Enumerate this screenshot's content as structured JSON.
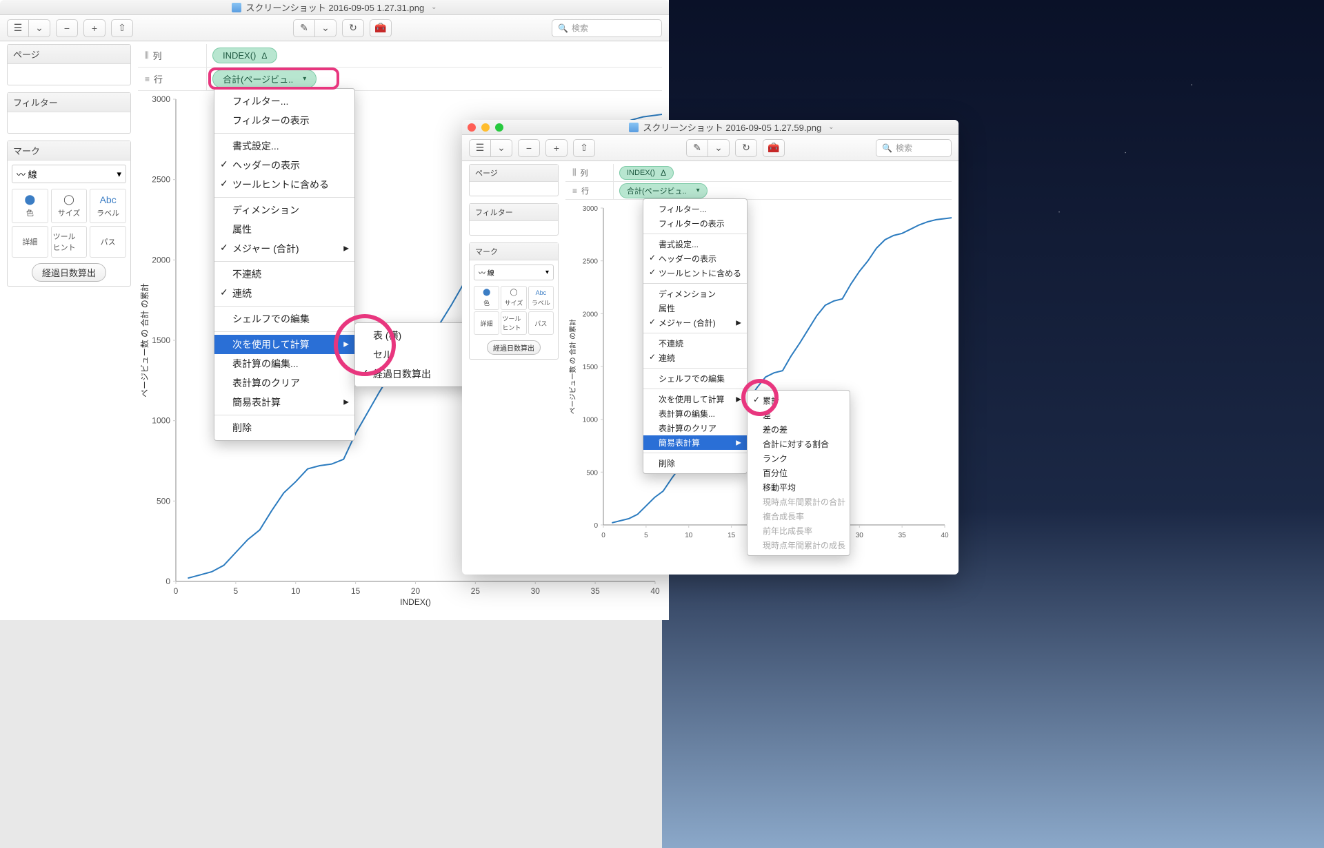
{
  "window1": {
    "title": "スクリーンショット 2016-09-05 1.27.31.png",
    "search_placeholder": "検索",
    "shelves": {
      "columns_label": "列",
      "columns_pill": "INDEX()",
      "rows_label": "行",
      "rows_pill": "合計(ページビュ.."
    },
    "side": {
      "pages": "ページ",
      "filter": "フィルター",
      "marks": "マーク",
      "marks_type": "線",
      "cells": {
        "color": "色",
        "size": "サイズ",
        "label": "ラベル",
        "detail": "詳細",
        "tooltip": "ツール\nヒント",
        "path": "パス"
      },
      "field": "経過日数算出"
    },
    "menu1": {
      "filter": "フィルター...",
      "show_filter": "フィルターの表示",
      "format": "書式設定...",
      "show_header": "ヘッダーの表示",
      "include_tooltip": "ツールヒントに含める",
      "dimension": "ディメンション",
      "attribute": "属性",
      "measure_sum": "メジャー (合計)",
      "discrete": "不連続",
      "continuous": "連続",
      "edit_shelf": "シェルフでの編集",
      "compute_using": "次を使用して計算",
      "edit_tablecalc": "表計算の編集...",
      "clear_tablecalc": "表計算のクリア",
      "quick_tablecalc": "簡易表計算",
      "remove": "削除"
    },
    "submenu1": {
      "table": "表 (横)",
      "cell": "セル",
      "elapsed": "経過日数算出"
    }
  },
  "window2": {
    "title": "スクリーンショット 2016-09-05 1.27.59.png",
    "search_placeholder": "検索",
    "shelves": {
      "columns_label": "列",
      "columns_pill": "INDEX()",
      "rows_label": "行",
      "rows_pill": "合計(ページビュ.."
    },
    "side": {
      "pages": "ページ",
      "filter": "フィルター",
      "marks": "マーク",
      "marks_type": "線",
      "cells": {
        "color": "色",
        "size": "サイズ",
        "label": "ラベル",
        "detail": "詳細",
        "tooltip": "ツール\nヒント",
        "path": "パス"
      },
      "field": "経過日数算出"
    },
    "menu2": {
      "filter": "フィルター...",
      "show_filter": "フィルターの表示",
      "format": "書式設定...",
      "show_header": "ヘッダーの表示",
      "include_tooltip": "ツールヒントに含める",
      "dimension": "ディメンション",
      "attribute": "属性",
      "measure_sum": "メジャー (合計)",
      "discrete": "不連続",
      "continuous": "連続",
      "edit_shelf": "シェルフでの編集",
      "compute_using": "次を使用して計算",
      "edit_tablecalc": "表計算の編集...",
      "clear_tablecalc": "表計算のクリア",
      "quick_tablecalc": "簡易表計算",
      "remove": "削除"
    },
    "submenu2": {
      "running_total": "累計",
      "difference": "差",
      "pct_diff": "差の差",
      "pct_of_total": "合計に対する割合",
      "rank": "ランク",
      "percentile": "百分位",
      "moving_avg": "移動平均",
      "ytd_total": "現時点年間累計の合計",
      "compound_growth": "複合成長率",
      "yoy_growth": "前年比成長率",
      "ytd_growth": "現時点年間累計の成長"
    }
  },
  "chart_data": [
    {
      "type": "line",
      "title": "",
      "xlabel": "INDEX()",
      "ylabel": "ページビュー数 の 合計 の累計",
      "xlim": [
        0,
        40
      ],
      "ylim": [
        0,
        3000
      ],
      "xticks": [
        0,
        5,
        10,
        15,
        20,
        25,
        30,
        35,
        40
      ],
      "yticks": [
        0,
        500,
        1000,
        1500,
        2000,
        2500,
        3000
      ],
      "x": [
        1,
        2,
        3,
        4,
        5,
        6,
        7,
        8,
        9,
        10,
        11,
        12,
        13,
        14,
        15,
        16,
        17,
        18,
        19,
        20,
        21,
        22,
        23,
        24,
        25,
        26,
        27,
        28,
        29,
        30,
        31,
        32,
        33,
        34,
        35,
        36,
        37,
        38,
        39,
        40,
        41,
        42,
        43
      ],
      "values": [
        20,
        40,
        60,
        100,
        180,
        260,
        320,
        440,
        550,
        620,
        700,
        720,
        730,
        760,
        920,
        1050,
        1180,
        1300,
        1400,
        1440,
        1460,
        1600,
        1720,
        1850,
        1980,
        2080,
        2120,
        2140,
        2280,
        2400,
        2500,
        2620,
        2700,
        2740,
        2760,
        2800,
        2840,
        2870,
        2890,
        2900,
        2910,
        2920,
        2930
      ]
    },
    {
      "type": "line",
      "title": "",
      "xlabel": "INDEX()",
      "ylabel": "ページビュー数 の 合計 の累計",
      "xlim": [
        0,
        40
      ],
      "ylim": [
        0,
        3000
      ],
      "xticks": [
        0,
        5,
        10,
        15,
        20,
        25,
        30,
        35,
        40
      ],
      "yticks": [
        0,
        500,
        1000,
        1500,
        2000,
        2500,
        3000
      ],
      "x": [
        1,
        2,
        3,
        4,
        5,
        6,
        7,
        8,
        9,
        10,
        11,
        12,
        13,
        14,
        15,
        16,
        17,
        18,
        19,
        20,
        21,
        22,
        23,
        24,
        25,
        26,
        27,
        28,
        29,
        30,
        31,
        32,
        33,
        34,
        35,
        36,
        37,
        38,
        39,
        40,
        41,
        42,
        43
      ],
      "values": [
        20,
        40,
        60,
        100,
        180,
        260,
        320,
        440,
        550,
        620,
        700,
        720,
        730,
        760,
        920,
        1050,
        1180,
        1300,
        1400,
        1440,
        1460,
        1600,
        1720,
        1850,
        1980,
        2080,
        2120,
        2140,
        2280,
        2400,
        2500,
        2620,
        2700,
        2740,
        2760,
        2800,
        2840,
        2870,
        2890,
        2900,
        2910,
        2920,
        2930
      ]
    }
  ]
}
